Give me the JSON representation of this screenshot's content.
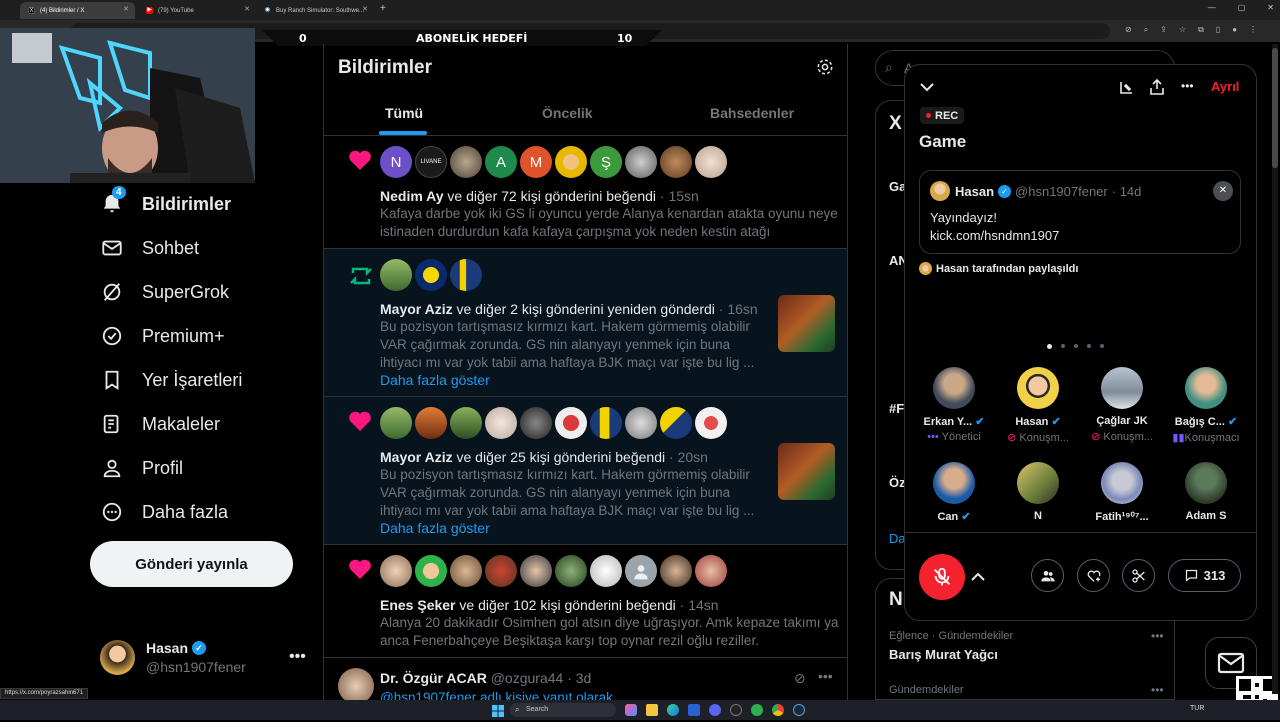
{
  "browser": {
    "tabs": [
      {
        "title": "(4) Bildirimler / X",
        "active": true
      },
      {
        "title": "(79) YouTube",
        "active": false
      },
      {
        "title": "Buy Ranch Simulator: Southwe...",
        "active": false
      }
    ],
    "status_url": "https://x.com/poyrazsahin671"
  },
  "banner": {
    "left": "0",
    "title": "ABONELİK HEDEFİ",
    "right": "10"
  },
  "sidebar": {
    "items": [
      {
        "label": "Bildirimler",
        "badge": "4",
        "icon": "bell-icon"
      },
      {
        "label": "Sohbet",
        "icon": "mail-icon"
      },
      {
        "label": "SuperGrok",
        "icon": "grok-icon"
      },
      {
        "label": "Premium+",
        "icon": "verified-icon"
      },
      {
        "label": "Yer İşaretleri",
        "icon": "bookmark-icon"
      },
      {
        "label": "Makaleler",
        "icon": "article-icon"
      },
      {
        "label": "Profil",
        "icon": "person-icon"
      },
      {
        "label": "Daha fazla",
        "icon": "more-circle-icon"
      }
    ],
    "post_button": "Gönderi yayınla",
    "account": {
      "name": "Hasan",
      "handle": "@hsn1907fener"
    }
  },
  "main": {
    "title": "Bildirimler",
    "tabs": [
      "Tümü",
      "Öncelik",
      "Bahsedenler"
    ],
    "notifications": [
      {
        "type": "like",
        "avatars": [
          "N",
          "LIVANE",
          "",
          "A",
          "M",
          "",
          "Ş",
          "",
          "",
          ""
        ],
        "actor": "Nedim Ay",
        "rest": " ve diğer 72 kişi gönderini beğendi",
        "time": " · 15sn",
        "quote": "Kafaya darbe yok iki GS li oyuncu yerde Alanya kenardan atakta oyunu neye istinaden durdurdun kafa kafaya çarpışma yok neden kestin atağı"
      },
      {
        "type": "repost",
        "actor": "Mayor Aziz",
        "rest": " ve diğer 2 kişi gönderini yeniden gönderdi",
        "time": " · 16sn",
        "quote": "Bu pozisyon tartışmasız kırmızı kart. Hakem görmemiş olabilir VAR çağırmak zorunda. GS nin alanyayı yenmek için buna ihtiyacı mı var yok tabii ama haftaya BJK maçı var işte bu lig ...",
        "more": "Daha fazla göster"
      },
      {
        "type": "like",
        "actor": "Mayor Aziz",
        "rest": " ve diğer 25 kişi gönderini beğendi",
        "time": " · 20sn",
        "quote": "Bu pozisyon tartışmasız kırmızı kart. Hakem görmemiş olabilir VAR çağırmak zorunda. GS nin alanyayı yenmek için buna ihtiyacı mı var yok tabii ama haftaya BJK maçı var işte bu lig ...",
        "more": "Daha fazla göster"
      },
      {
        "type": "like",
        "actor": "Enes Şeker",
        "rest": " ve diğer 102 kişi gönderini beğendi",
        "time": " · 14sn",
        "quote": "Alanya 20 dakikadır Osimhen gol atsın diye uğraşıyor. Amk kepaze takımı ya anca Fenerbahçeye Beşiktaşa karşı top oynar rezil oğlu reziller."
      },
      {
        "type": "reply",
        "actor": "Dr. Özgür ACAR",
        "handle": "@ozgura44",
        "time": " · 3d",
        "quote": "@hsn1907fener adlı kişiye yanıt olarak"
      }
    ]
  },
  "search": {
    "placeholder": "A"
  },
  "trends": {
    "title_fragment": "X",
    "items": [
      {
        "category": "Eğlence · Gündemdekiler",
        "name": "Barış Murat Yağcı"
      },
      {
        "category": "Gündemdekiler",
        "name": ""
      }
    ],
    "section_fragment": "N",
    "fragments": [
      "Ga",
      "AN",
      "#F",
      "Öz",
      "Da"
    ]
  },
  "space": {
    "rec": "REC",
    "title": "Game",
    "leave": "Ayrıl",
    "pinned": {
      "name": "Hasan",
      "handle": "@hsn1907fener",
      "time": " · 14d",
      "text1": "Yayındayız!",
      "text2": "kick.com/hsndmn1907",
      "shared_by": "Hasan tarafından paylaşıldı"
    },
    "speakers": [
      {
        "name": "Erkan Y...",
        "role": "Yönetici",
        "verified": true
      },
      {
        "name": "Hasan",
        "role": "Konuşm...",
        "verified": true
      },
      {
        "name": "Çağlar JK",
        "role": "Konuşm...",
        "verified": false
      },
      {
        "name": "Bağış C...",
        "role": "Konuşmacı",
        "verified": true
      },
      {
        "name": "Can",
        "role": "",
        "verified": true
      },
      {
        "name": "N",
        "role": "",
        "verified": false
      },
      {
        "name": "Fatih¹⁹⁰⁷...",
        "role": "",
        "verified": false
      },
      {
        "name": "Adam S",
        "role": "",
        "verified": false
      }
    ],
    "comment_count": "313"
  },
  "taskbar": {
    "search": "Search",
    "lang": "TUR"
  },
  "colors": {
    "accent": "#1d9bf0",
    "like": "#f91880",
    "repost": "#00ba7c",
    "danger": "#f4212e"
  }
}
